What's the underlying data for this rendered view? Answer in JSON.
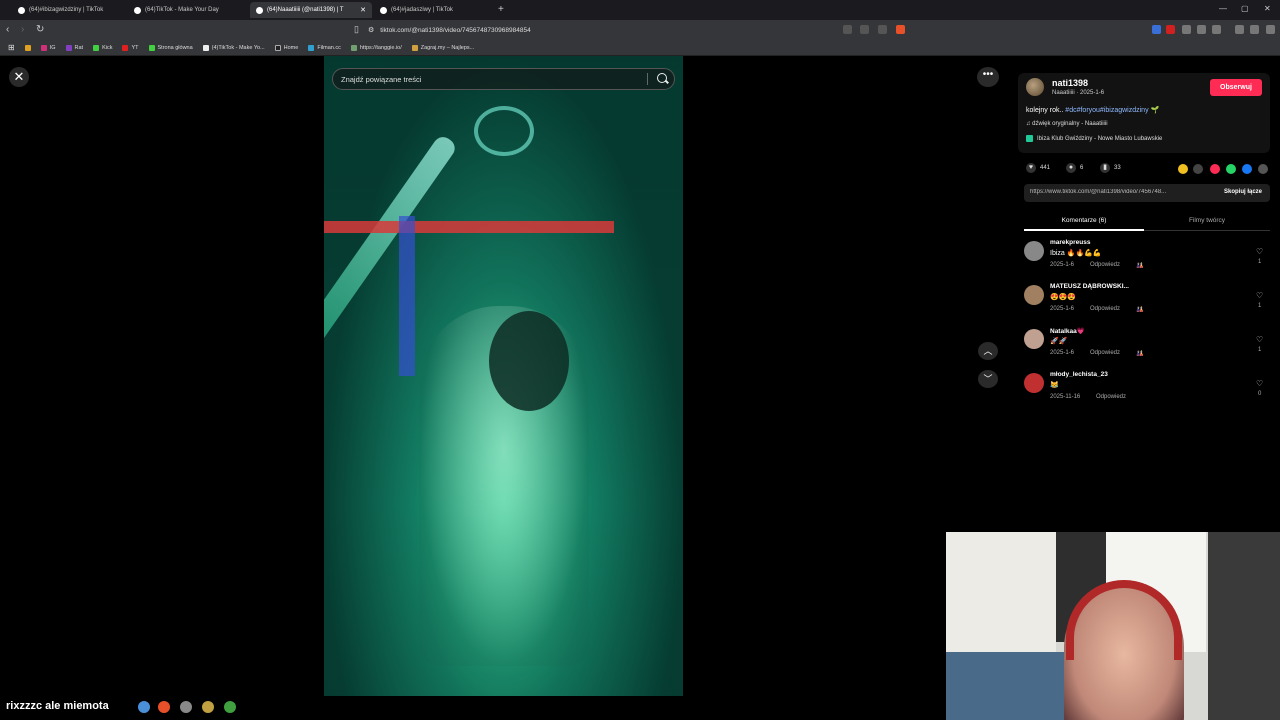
{
  "tabs": [
    {
      "title": "(64)#ibizagwizdziny | TikTok",
      "active": false
    },
    {
      "title": "(64)TikTok - Make Your Day",
      "active": false
    },
    {
      "title": "(64)Naaatiiiii (@nati1398) | T",
      "active": true
    },
    {
      "title": "(64)#jadasziwy | TikTok",
      "active": false
    }
  ],
  "url": "tiktok.com/@nati1398/video/7456748730968984854",
  "bookmarks": [
    "IG",
    "Rat",
    "Kick",
    "YT",
    "Strona główna",
    "(4)TikTok - Make Yo...",
    "Home",
    "Filman.cc",
    "https://tanggie.io/",
    "Zagraj.my – Najleps..."
  ],
  "search": {
    "placeholder": "Znajdź powiązane treści"
  },
  "author": {
    "username": "nati1398",
    "subtitle": "Naaatiiiii · 2025-1-6",
    "follow_label": "Obserwuj",
    "description_text": "kolejny rok.. ",
    "description_tags": "#dc#foryou#ibizagwizdziny",
    "sound": "♫ dźwięk oryginalny - Naaatiiiii",
    "location": "Ibiza Klub Gwiździny - Nowe Miasto Lubawskie"
  },
  "stats": {
    "likes": "441",
    "comments": "6",
    "saves": "33"
  },
  "share_link": {
    "url": "https://www.tiktok.com/@nati1398/video/7456748...",
    "copy_label": "Skopiuj łącze"
  },
  "panel_tabs": {
    "comments": "Komentarze (6)",
    "creator_videos": "Filmy twórcy"
  },
  "comments": [
    {
      "user": "marekpreuss",
      "text": "Ibiza 🔥🔥💪💪",
      "date": "2025-1-6",
      "reply": "Odpowiedz",
      "likes": "1",
      "avatar_color": "#888888"
    },
    {
      "user": "MATEUSZ DĄBROWSKI...",
      "text": "😍😍😍",
      "date": "2025-1-6",
      "reply": "Odpowiedz",
      "likes": "1",
      "avatar_color": "#a08060"
    },
    {
      "user": "Natalkaa💗",
      "text": "🚀🚀",
      "date": "2025-1-6",
      "reply": "Odpowiedz",
      "likes": "1",
      "avatar_color": "#c0a090"
    },
    {
      "user": "młody_lechista_23",
      "text": "😹",
      "date": "2025-11-16",
      "reply": "Odpowiedz",
      "likes": "0",
      "avatar_color": "#c03030"
    }
  ],
  "taskbar": {
    "text": "rixzzzc ale miemota"
  }
}
